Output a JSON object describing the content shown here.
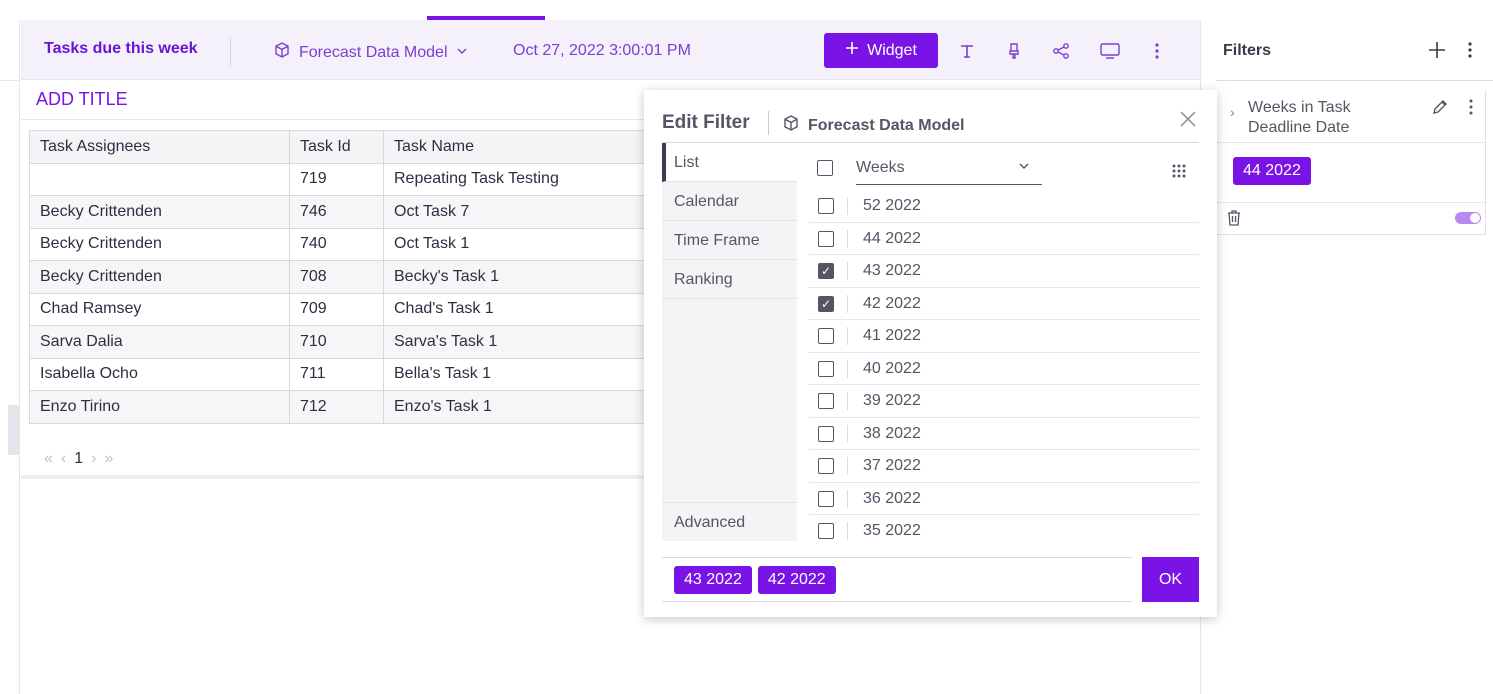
{
  "dashboard": {
    "title": "Tasks due this week",
    "model": "Forecast Data Model",
    "date": "Oct 27, 2022 3:00:01 PM",
    "widget_label": "Widget",
    "add_title": "ADD TITLE"
  },
  "table": {
    "columns": [
      "Task Assignees",
      "Task Id",
      "Task Name"
    ],
    "rows": [
      [
        "",
        "719",
        "Repeating Task Testing"
      ],
      [
        "Becky Crittenden",
        "746",
        "Oct Task 7"
      ],
      [
        "Becky Crittenden",
        "740",
        "Oct Task 1"
      ],
      [
        "Becky Crittenden",
        "708",
        "Becky's Task 1"
      ],
      [
        "Chad Ramsey",
        "709",
        "Chad's Task 1"
      ],
      [
        "Sarva Dalia",
        "710",
        "Sarva's Task 1"
      ],
      [
        "Isabella Ocho",
        "711",
        "Bella's Task 1"
      ],
      [
        "Enzo Tirino",
        "712",
        "Enzo's Task 1"
      ]
    ],
    "page": "1"
  },
  "filters_panel": {
    "title": "Filters",
    "filter_name": "Weeks in Task Deadline Date",
    "selected_chip": "44 2022"
  },
  "edit_filter": {
    "title": "Edit Filter",
    "model": "Forecast Data Model",
    "tabs": [
      "List",
      "Calendar",
      "Time Frame",
      "Ranking"
    ],
    "advanced": "Advanced",
    "dropdown": "Weeks",
    "items": [
      {
        "label": "52 2022",
        "checked": false
      },
      {
        "label": "44 2022",
        "checked": false
      },
      {
        "label": "43 2022",
        "checked": true
      },
      {
        "label": "42 2022",
        "checked": true
      },
      {
        "label": "41 2022",
        "checked": false
      },
      {
        "label": "40 2022",
        "checked": false
      },
      {
        "label": "39 2022",
        "checked": false
      },
      {
        "label": "38 2022",
        "checked": false
      },
      {
        "label": "37 2022",
        "checked": false
      },
      {
        "label": "36 2022",
        "checked": false
      },
      {
        "label": "35 2022",
        "checked": false
      }
    ],
    "selected": [
      "43 2022",
      "42 2022"
    ],
    "ok": "OK"
  },
  "colors": {
    "accent": "#7a14e6",
    "header_bg": "#f4f1fb"
  }
}
